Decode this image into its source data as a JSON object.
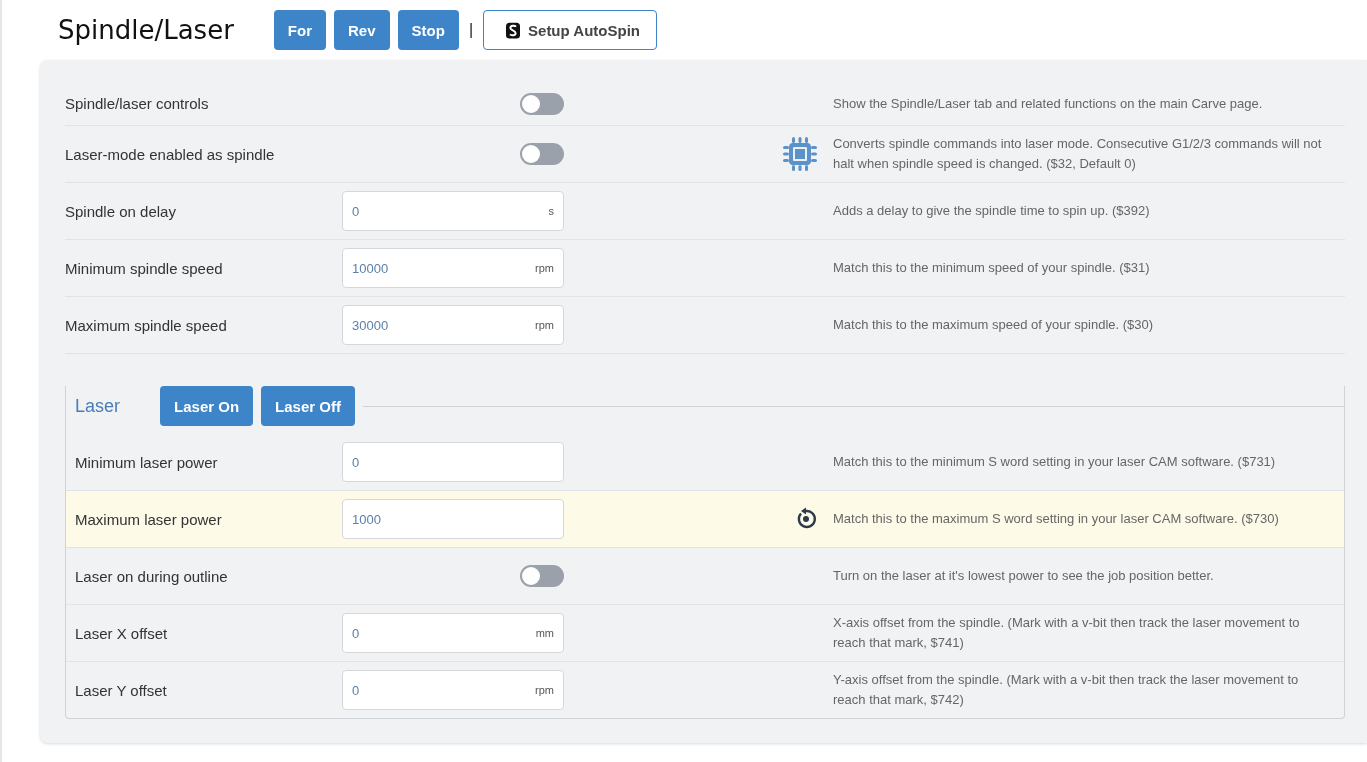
{
  "header": {
    "title": "Spindle/Laser",
    "buttons": [
      {
        "label": "For",
        "kind": "primary"
      },
      {
        "label": "Rev",
        "kind": "primary"
      },
      {
        "label": "Stop",
        "kind": "primary"
      },
      {
        "label": "Setup AutoSpin",
        "kind": "outline"
      }
    ],
    "separator": "|"
  },
  "settings": [
    {
      "kind": "toggle",
      "label": "Spindle/laser controls",
      "on": false,
      "modified": false,
      "description": "Show the Spindle/Laser tab and related functions on the main Carve page."
    },
    {
      "kind": "toggle",
      "label": "Laser-mode enabled as spindle",
      "on": false,
      "modified": false,
      "firmware_setting": true,
      "description": "Converts spindle commands into laser mode. Consecutive G1/2/3 commands will not halt when spindle speed is changed. ($32, Default 0)"
    },
    {
      "kind": "field",
      "label": "Spindle on delay",
      "value": "0",
      "unit": "s",
      "modified": false,
      "description": "Adds a delay to give the spindle time to spin up. ($392)"
    },
    {
      "kind": "field",
      "label": "Minimum spindle speed",
      "value": "10000",
      "unit": "rpm",
      "modified": false,
      "description": "Match this to the minimum speed of your spindle. ($31)"
    },
    {
      "kind": "field",
      "label": "Maximum spindle speed",
      "value": "30000",
      "unit": "rpm",
      "modified": false,
      "description": "Match this to the maximum speed of your spindle. ($30)"
    }
  ],
  "laser": {
    "legend": "Laser",
    "buttons": [
      "Laser On",
      "Laser Off"
    ],
    "settings": [
      {
        "kind": "field",
        "label": "Minimum laser power",
        "value": "0",
        "modified": false,
        "description": "Match this to the minimum S word setting in your laser CAM software. ($731)"
      },
      {
        "kind": "field",
        "label": "Maximum laser power",
        "value": "1000",
        "modified": true,
        "description": "Match this to the maximum S word setting in your laser CAM software. ($730)"
      },
      {
        "kind": "toggle",
        "label": "Laser on during outline",
        "on": false,
        "modified": false,
        "description": "Turn on the laser at it's lowest power to see the job position better."
      },
      {
        "kind": "field",
        "label": "Laser X offset",
        "value": "0",
        "unit": "mm",
        "modified": false,
        "description": "X-axis offset from the spindle. (Mark with a v-bit then track the laser movement to reach that mark, $741)"
      },
      {
        "kind": "field",
        "label": "Laser Y offset",
        "value": "0",
        "unit": "rpm",
        "modified": false,
        "description": "Y-axis offset from the spindle. (Mark with a v-bit then track the laser movement to reach that mark, $742)"
      }
    ]
  }
}
